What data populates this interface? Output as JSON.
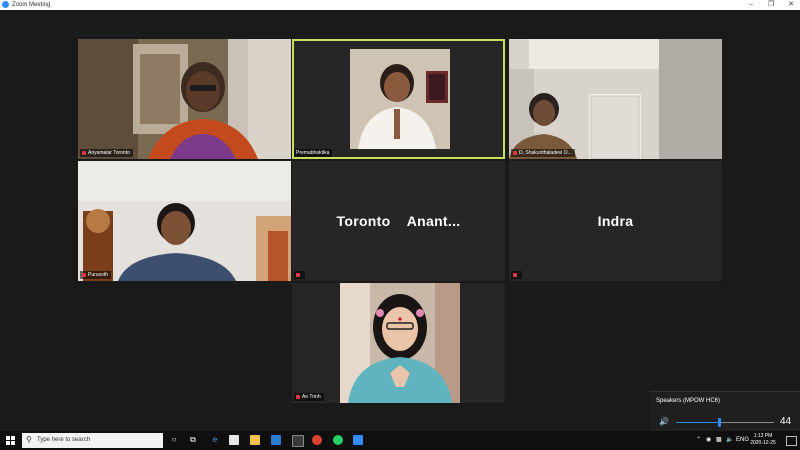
{
  "window": {
    "title": "Zoom Meeting",
    "controls": [
      "minimize",
      "maximize",
      "close"
    ]
  },
  "participants": [
    {
      "name": "Ariyamalar Toronto",
      "video": true,
      "muted": true,
      "active": false
    },
    {
      "name": "Premabhaktika",
      "video": true,
      "muted": false,
      "active": true
    },
    {
      "name": "D, Shakunthaladevi O...",
      "video": true,
      "muted": true,
      "active": false
    },
    {
      "name": "Purusoth",
      "video": true,
      "muted": true,
      "active": false
    },
    {
      "name": "",
      "video": false,
      "muted": true,
      "active": false,
      "display_name": "Toronto    Anant..."
    },
    {
      "name": "",
      "video": false,
      "muted": true,
      "active": false,
      "display_name": "Indra"
    },
    {
      "name": "An Trinh",
      "video": true,
      "muted": true,
      "active": false
    }
  ],
  "volume_popup": {
    "device": "Speakers (MPOW HC6)",
    "level": 44,
    "level_fraction": 0.44
  },
  "taskbar": {
    "search_placeholder": "Type here to search",
    "tray": {
      "language": "ENG",
      "time": "1:13 PM",
      "date": "2020-12-25"
    }
  },
  "colors": {
    "active_speaker_border": "#c6e05a",
    "muted_icon": "#e0393e",
    "accent": "#2d8cff",
    "tile_background": "#262626"
  }
}
